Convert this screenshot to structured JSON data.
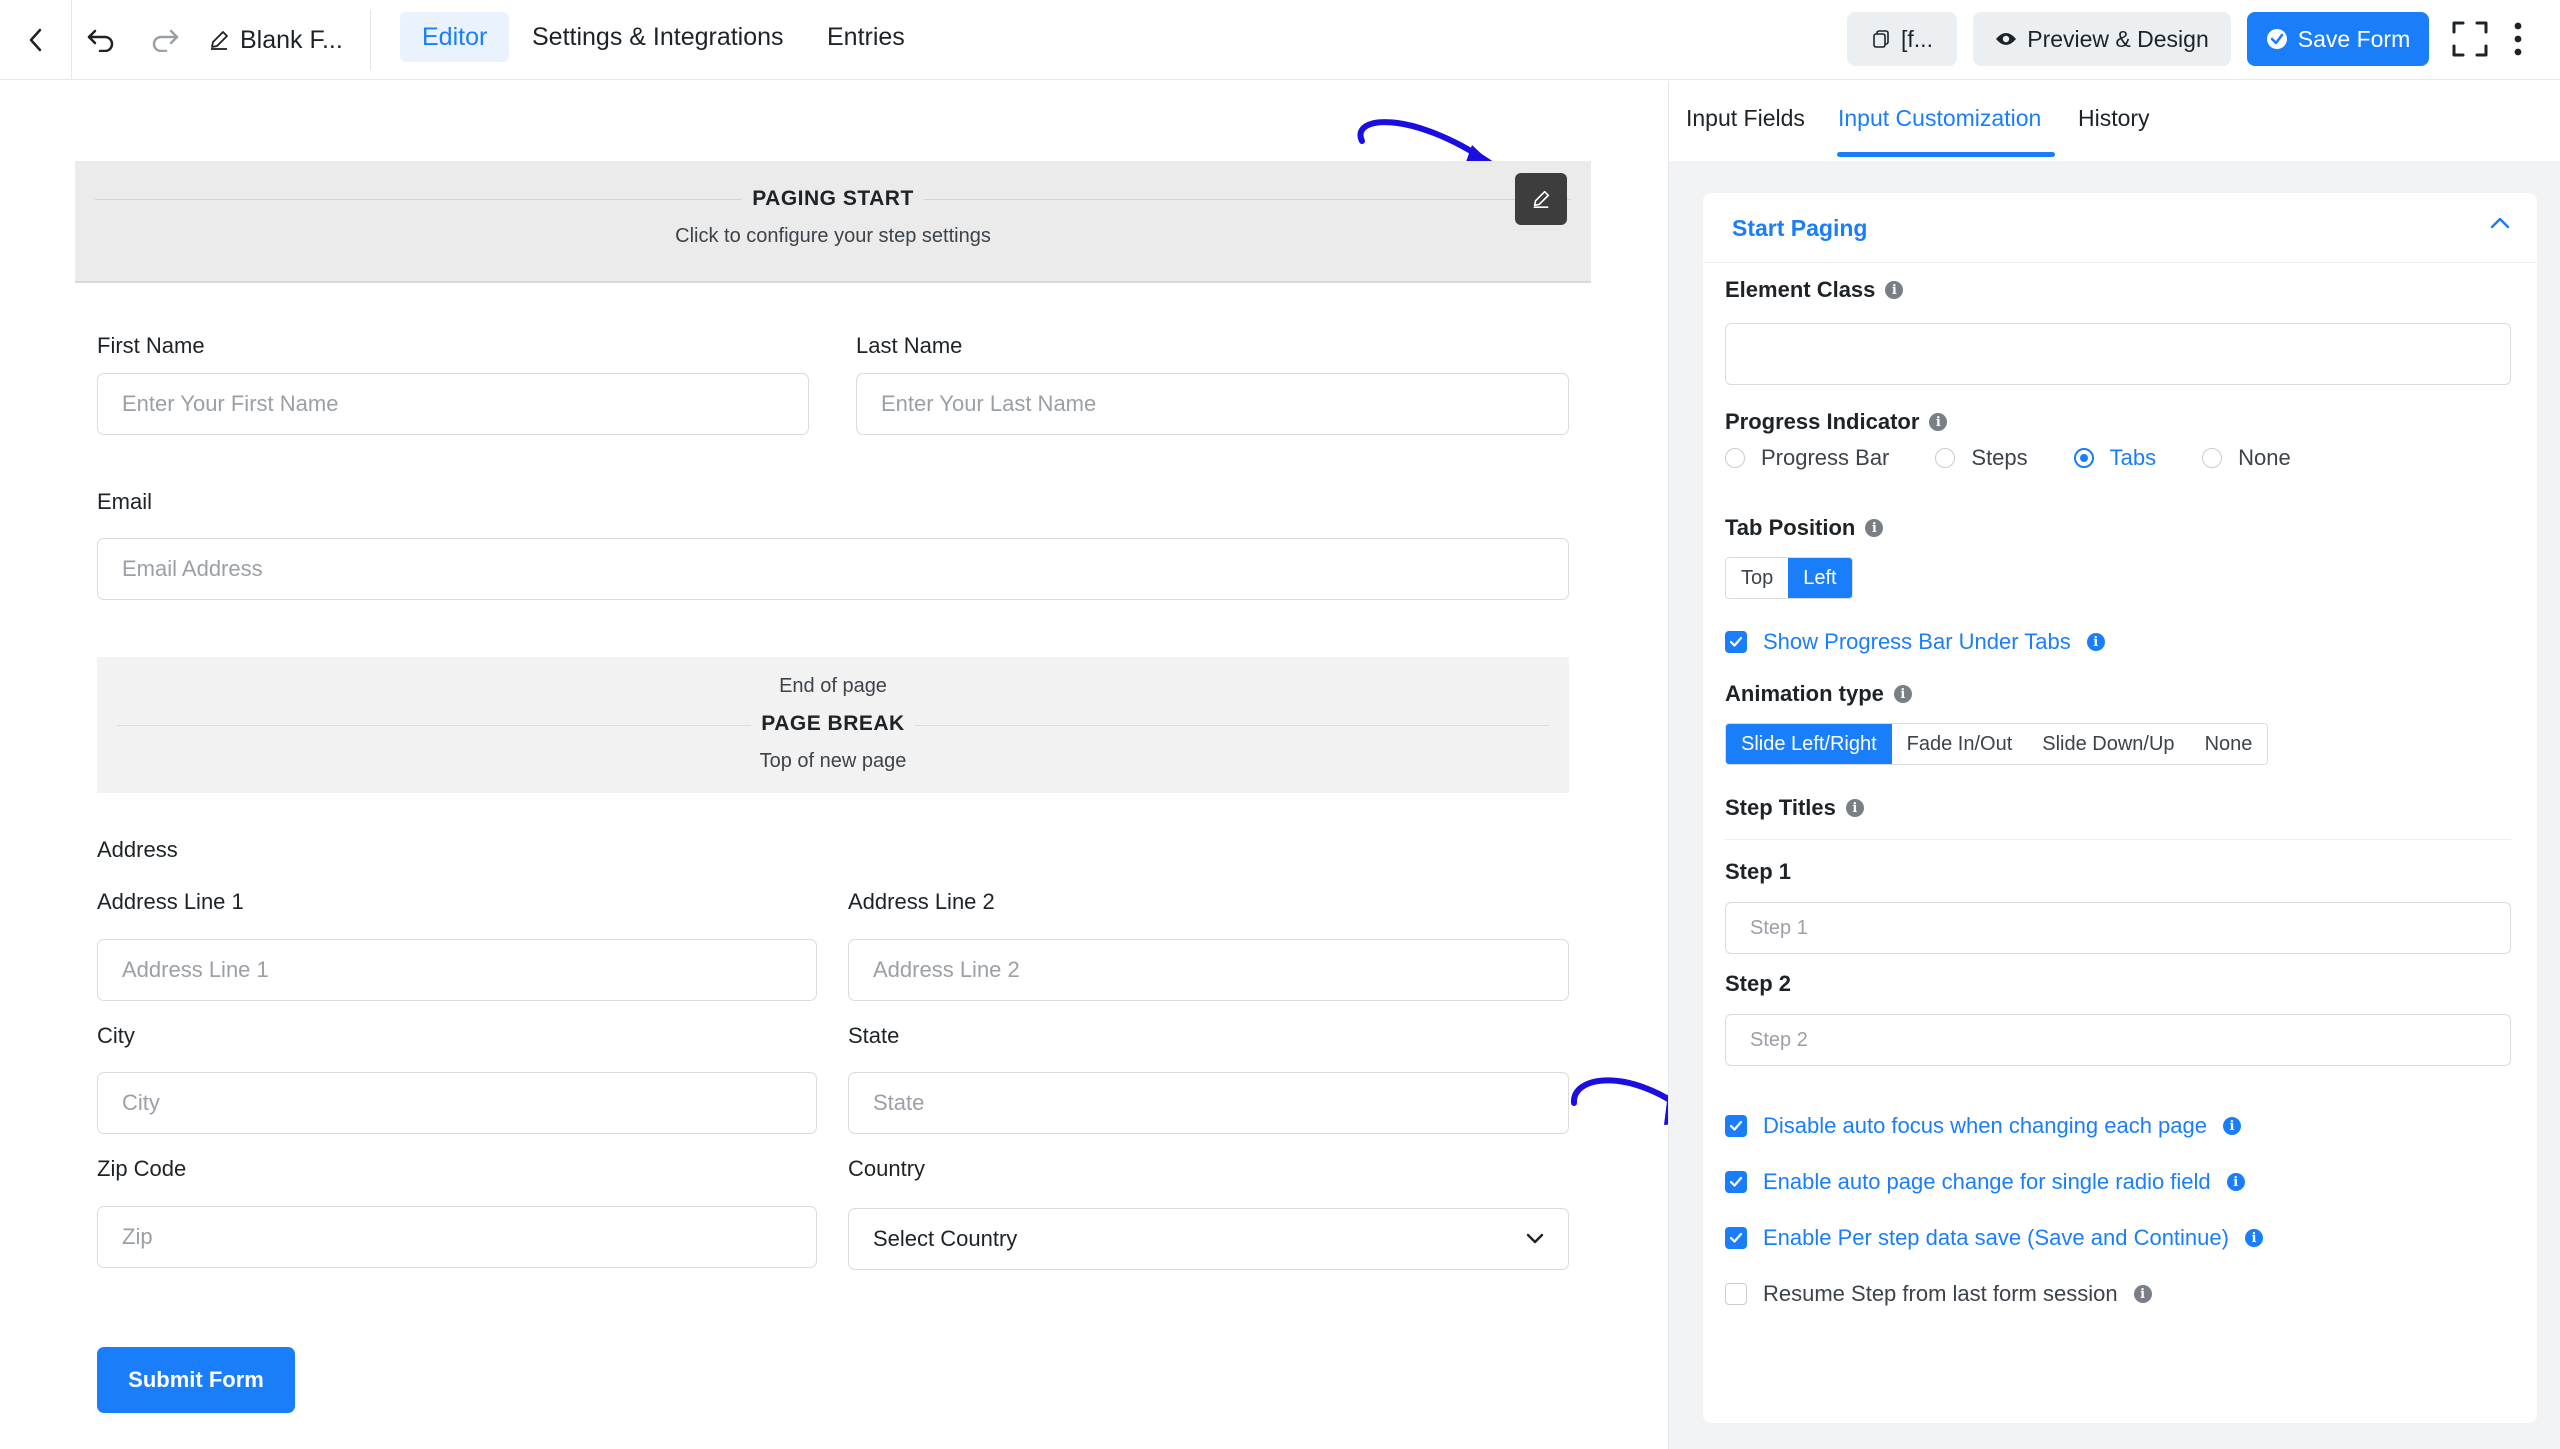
{
  "colors": {
    "accent": "#1a7efb",
    "annotation_arrow": "#1a0ee0",
    "panel_bg": "#f2f3f5"
  },
  "topbar": {
    "title": "Blank F...",
    "tabs": [
      {
        "label": "Editor",
        "active": true
      },
      {
        "label": "Settings & Integrations",
        "active": false
      },
      {
        "label": "Entries",
        "active": false
      }
    ],
    "shortcode_label": "[f...",
    "preview_label": "Preview & Design",
    "save_label": "Save Form",
    "icons": [
      "chevron-left-icon",
      "undo-icon",
      "redo-icon",
      "pencil-icon",
      "copy-icon",
      "eye-icon",
      "check-circle-icon",
      "fullscreen-icon",
      "more-vertical-icon"
    ]
  },
  "form": {
    "paging_start": {
      "title": "PAGING START",
      "subtitle": "Click to configure your step settings"
    },
    "first_name": {
      "label": "First Name",
      "placeholder": "Enter Your First Name"
    },
    "last_name": {
      "label": "Last Name",
      "placeholder": "Enter Your Last Name"
    },
    "email": {
      "label": "Email",
      "placeholder": "Email Address"
    },
    "page_break": {
      "top": "End of page",
      "title": "PAGE BREAK",
      "bottom": "Top of new page"
    },
    "address": {
      "label": "Address",
      "line1": {
        "label": "Address Line 1",
        "placeholder": "Address Line 1"
      },
      "line2": {
        "label": "Address Line 2",
        "placeholder": "Address Line 2"
      },
      "city": {
        "label": "City",
        "placeholder": "City"
      },
      "state": {
        "label": "State",
        "placeholder": "State"
      },
      "zip": {
        "label": "Zip Code",
        "placeholder": "Zip"
      },
      "country": {
        "label": "Country",
        "value": "Select Country"
      }
    },
    "submit_label": "Submit Form"
  },
  "panel": {
    "tabs": [
      {
        "label": "Input Fields",
        "active": false
      },
      {
        "label": "Input Customization",
        "active": true
      },
      {
        "label": "History",
        "active": false
      }
    ],
    "section_title": "Start Paging",
    "element_class": {
      "label": "Element Class",
      "value": ""
    },
    "progress_indicator": {
      "label": "Progress Indicator",
      "options": [
        "Progress Bar",
        "Steps",
        "Tabs",
        "None"
      ],
      "selected": "Tabs"
    },
    "tab_position": {
      "label": "Tab Position",
      "options": [
        "Top",
        "Left"
      ],
      "selected": "Left"
    },
    "show_progress_bar": {
      "label": "Show Progress Bar Under Tabs",
      "checked": true
    },
    "animation": {
      "label": "Animation type",
      "options": [
        "Slide Left/Right",
        "Fade In/Out",
        "Slide Down/Up",
        "None"
      ],
      "selected": "Slide Left/Right"
    },
    "step_titles": {
      "label": "Step Titles",
      "steps": [
        {
          "label": "Step 1",
          "placeholder": "Step 1"
        },
        {
          "label": "Step 2",
          "placeholder": "Step 2"
        }
      ]
    },
    "options": [
      {
        "label": "Disable auto focus when changing each page",
        "checked": true
      },
      {
        "label": "Enable auto page change for single radio field",
        "checked": true
      },
      {
        "label": "Enable Per step data save (Save and Continue)",
        "checked": true
      },
      {
        "label": "Resume Step from last form session",
        "checked": false
      }
    ]
  }
}
